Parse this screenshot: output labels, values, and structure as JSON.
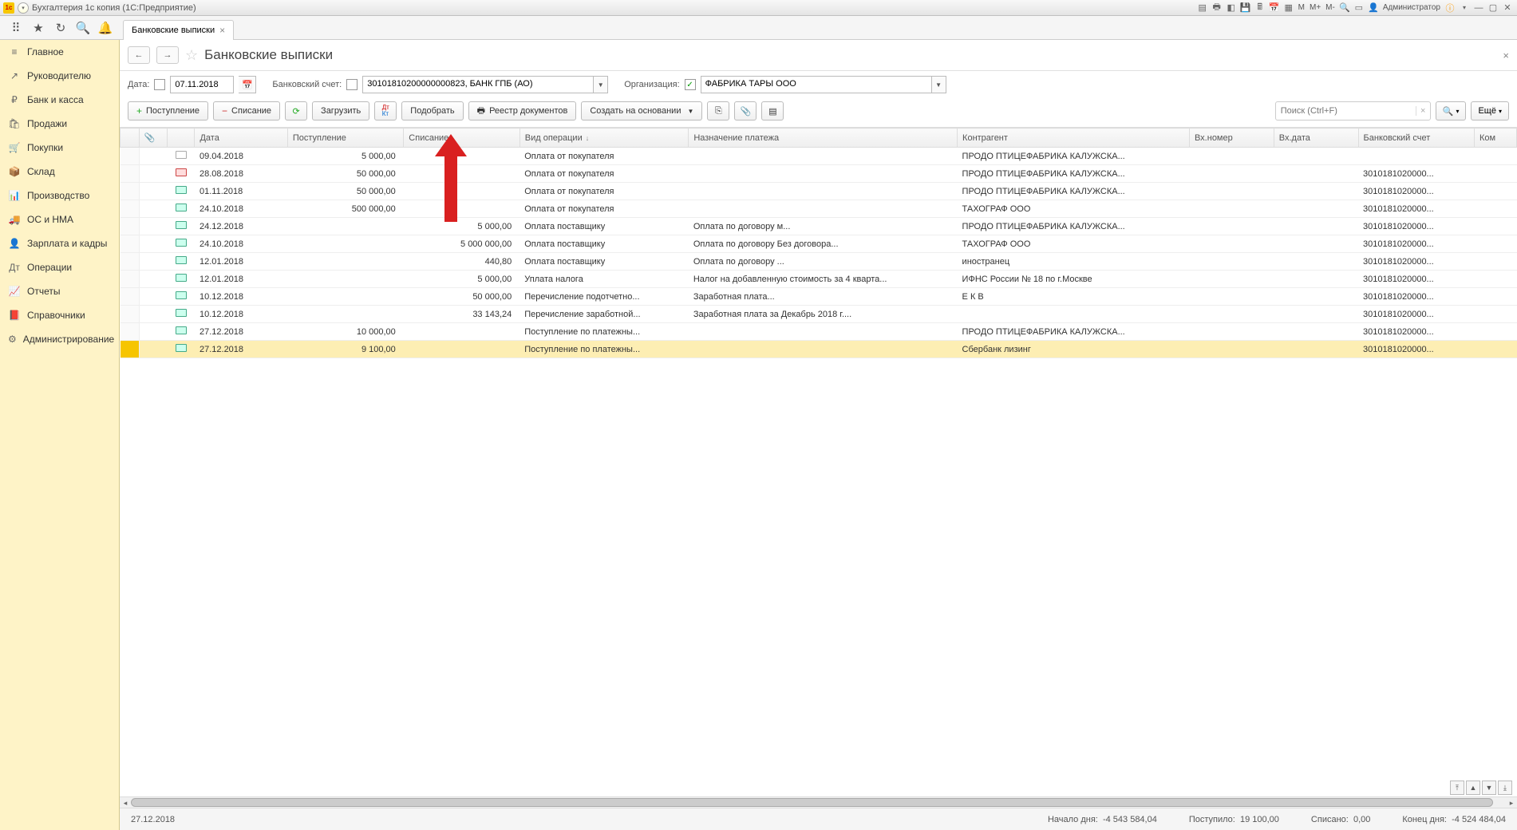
{
  "titlebar": {
    "title": "Бухгалтерия 1с копия  (1С:Предприятие)",
    "user_label": "Администратор",
    "m_btn": "M",
    "mplus_btn": "M+",
    "mminus_btn": "M-"
  },
  "tab": {
    "label": "Банковские выписки"
  },
  "sidebar": {
    "items": [
      {
        "icon": "≡",
        "label": "Главное"
      },
      {
        "icon": "↗",
        "label": "Руководителю"
      },
      {
        "icon": "₽",
        "label": "Банк и касса"
      },
      {
        "icon": "🛍",
        "label": "Продажи"
      },
      {
        "icon": "🛒",
        "label": "Покупки"
      },
      {
        "icon": "📦",
        "label": "Склад"
      },
      {
        "icon": "📊",
        "label": "Производство"
      },
      {
        "icon": "🚚",
        "label": "ОС и НМА"
      },
      {
        "icon": "👤",
        "label": "Зарплата и кадры"
      },
      {
        "icon": "Дт",
        "label": "Операции"
      },
      {
        "icon": "📈",
        "label": "Отчеты"
      },
      {
        "icon": "📕",
        "label": "Справочники"
      },
      {
        "icon": "⚙",
        "label": "Администрирование"
      }
    ]
  },
  "page": {
    "title": "Банковские выписки"
  },
  "filters": {
    "date_label": "Дата:",
    "date_value": "07.11.2018",
    "account_label": "Банковский счет:",
    "account_value": "30101810200000000823, БАНК ГПБ (АО)",
    "org_label": "Организация:",
    "org_value": "ФАБРИКА ТАРЫ ООО"
  },
  "toolbar": {
    "receipt": "Поступление",
    "writeoff": "Списание",
    "load": "Загрузить",
    "pick": "Подобрать",
    "registry": "Реестр документов",
    "create_based": "Создать на основании",
    "search_placeholder": "Поиск (Ctrl+F)",
    "more": "Ещё"
  },
  "columns": {
    "attach": "📎",
    "date": "Дата",
    "income": "Поступление",
    "outcome": "Списание",
    "kind": "Вид операции",
    "purpose": "Назначение платежа",
    "counterparty": "Контрагент",
    "in_no": "Вх.номер",
    "in_date": "Вх.дата",
    "bank_acc": "Банковский счет",
    "comment": "Ком"
  },
  "rows": [
    {
      "icon": "plain",
      "date": "09.04.2018",
      "income": "5 000,00",
      "outcome": "",
      "kind": "Оплата от покупателя",
      "purpose": "",
      "counterparty": "ПРОДО ПТИЦЕФАБРИКА КАЛУЖСКА...",
      "bank": ""
    },
    {
      "icon": "red",
      "date": "28.08.2018",
      "income": "50 000,00",
      "outcome": "",
      "kind": "Оплата от покупателя",
      "purpose": "",
      "counterparty": "ПРОДО ПТИЦЕФАБРИКА КАЛУЖСКА...",
      "bank": "3010181020000..."
    },
    {
      "icon": "doc",
      "date": "01.11.2018",
      "income": "50 000,00",
      "outcome": "",
      "kind": "Оплата от покупателя",
      "purpose": "",
      "counterparty": "ПРОДО ПТИЦЕФАБРИКА КАЛУЖСКА...",
      "bank": "3010181020000..."
    },
    {
      "icon": "doc",
      "date": "24.10.2018",
      "income": "500 000,00",
      "outcome": "",
      "kind": "Оплата от покупателя",
      "purpose": "",
      "counterparty": "ТАХОГРАФ ООО",
      "bank": "3010181020000..."
    },
    {
      "icon": "doc",
      "date": "24.12.2018",
      "income": "",
      "outcome": "5 000,00",
      "kind": "Оплата поставщику",
      "purpose": "Оплата по договору м...",
      "counterparty": "ПРОДО ПТИЦЕФАБРИКА КАЛУЖСКА...",
      "bank": "3010181020000..."
    },
    {
      "icon": "doc",
      "date": "24.10.2018",
      "income": "",
      "outcome": "5 000 000,00",
      "kind": "Оплата поставщику",
      "purpose": "Оплата по договору Без договора...",
      "counterparty": "ТАХОГРАФ ООО",
      "bank": "3010181020000..."
    },
    {
      "icon": "doc",
      "date": "12.01.2018",
      "income": "",
      "outcome": "440,80",
      "kind": "Оплата поставщику",
      "purpose": "Оплата по договору ...",
      "counterparty": "иностранец",
      "bank": "3010181020000..."
    },
    {
      "icon": "doc",
      "date": "12.01.2018",
      "income": "",
      "outcome": "5 000,00",
      "kind": "Уплата налога",
      "purpose": "Налог на добавленную стоимость за 4 кварта...",
      "counterparty": "ИФНС России № 18 по г.Москве",
      "bank": "3010181020000..."
    },
    {
      "icon": "doc",
      "date": "10.12.2018",
      "income": "",
      "outcome": "50 000,00",
      "kind": "Перечисление подотчетно...",
      "purpose": "Заработная плата...",
      "counterparty": "Е К В",
      "bank": "3010181020000..."
    },
    {
      "icon": "doc",
      "date": "10.12.2018",
      "income": "",
      "outcome": "33 143,24",
      "kind": "Перечисление заработной...",
      "purpose": "Заработная плата за Декабрь 2018 г....",
      "counterparty": "",
      "bank": "3010181020000..."
    },
    {
      "icon": "doc",
      "date": "27.12.2018",
      "income": "10 000,00",
      "outcome": "",
      "kind": "Поступление по платежны...",
      "purpose": "",
      "counterparty": "ПРОДО ПТИЦЕФАБРИКА КАЛУЖСКА...",
      "bank": "3010181020000..."
    },
    {
      "icon": "doc",
      "date": "27.12.2018",
      "income": "9 100,00",
      "outcome": "",
      "kind": "Поступление по платежны...",
      "purpose": "",
      "counterparty": "Сбербанк лизинг",
      "bank": "3010181020000...",
      "selected": true
    }
  ],
  "status": {
    "date": "27.12.2018",
    "start_label": "Начало дня:",
    "start_val": "-4 543 584,04",
    "in_label": "Поступило:",
    "in_val": "19 100,00",
    "out_label": "Списано:",
    "out_val": "0,00",
    "end_label": "Конец дня:",
    "end_val": "-4 524 484,04"
  }
}
